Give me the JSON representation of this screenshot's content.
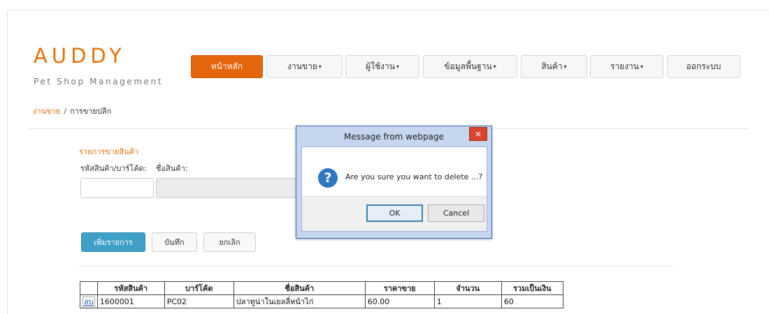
{
  "logo": {
    "title": "AUDDY",
    "subtitle": "Pet Shop Management"
  },
  "nav": {
    "home": "หน้าหลัก",
    "sales": "งานขาย",
    "users": "ผู้ใช้งาน",
    "master_data": "ข้อมูลพื้นฐาน",
    "products": "สินค้า",
    "reports": "รายงาน",
    "logout": "ออกระบบ",
    "caret": "▾"
  },
  "breadcrumb": {
    "parent": "งานขาย",
    "separator": "/",
    "current": "การขายปลีก"
  },
  "form": {
    "section_title": "รายการขายสินค้า",
    "code_label": "รหัสสินค้า/บาร์โค้ด:",
    "name_label": "ชื่อสินค้า:",
    "code_value": "",
    "name_value": ""
  },
  "buttons": {
    "add_item": "เพิ่มรายการ",
    "save": "บันทึก",
    "cancel": "ยกเลิก"
  },
  "table": {
    "headers": [
      "",
      "รหัสสินค้า",
      "บาร์โค้ด",
      "ชื่อสินค้า",
      "ราคาขาย",
      "จำนวน",
      "รวมเป็นเงิน"
    ],
    "rows": [
      {
        "action": "ลบ",
        "code": "1600001",
        "barcode": "PC02",
        "name": "ปลาทูน่าในเยลลี่หน้าไก่",
        "price": "60.00",
        "qty": "1",
        "total": "60"
      }
    ]
  },
  "dialog": {
    "title": "Message from webpage",
    "message": "Are you sure you want to delete ...?",
    "ok": "OK",
    "cancel": "Cancel",
    "close": "×",
    "icon": "?"
  },
  "colors": {
    "brand": "#e8720c",
    "nav_active": "#e5650c",
    "primary_button": "#3fa0c7",
    "dialog_frame": "#c6d6ee",
    "close_button": "#d9442f"
  }
}
